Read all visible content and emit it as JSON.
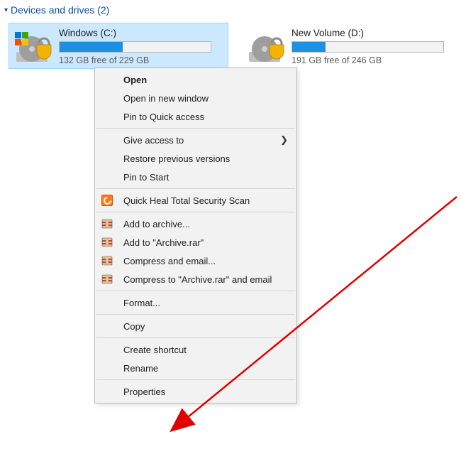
{
  "section": {
    "title": "Devices and drives (2)"
  },
  "drives": [
    {
      "name": "Windows (C:)",
      "subtext": "132 GB free of 229 GB",
      "fill_pct": 42,
      "selected": true,
      "has_windows_flag": true
    },
    {
      "name": "New Volume (D:)",
      "subtext": "191 GB free of 246 GB",
      "fill_pct": 22,
      "selected": false,
      "has_windows_flag": false
    }
  ],
  "context_menu": {
    "open": "Open",
    "open_new_window": "Open in new window",
    "pin_quick_access": "Pin to Quick access",
    "give_access_to": "Give access to",
    "restore_previous": "Restore previous versions",
    "pin_to_start": "Pin to Start",
    "quick_heal": "Quick Heal Total Security Scan",
    "add_to_archive": "Add to archive...",
    "add_to_archive_rar": "Add to \"Archive.rar\"",
    "compress_email": "Compress and email...",
    "compress_archive_email": "Compress to \"Archive.rar\" and email",
    "format": "Format...",
    "copy": "Copy",
    "create_shortcut": "Create shortcut",
    "rename": "Rename",
    "properties": "Properties"
  },
  "annotation": {
    "color": "#e00000"
  }
}
